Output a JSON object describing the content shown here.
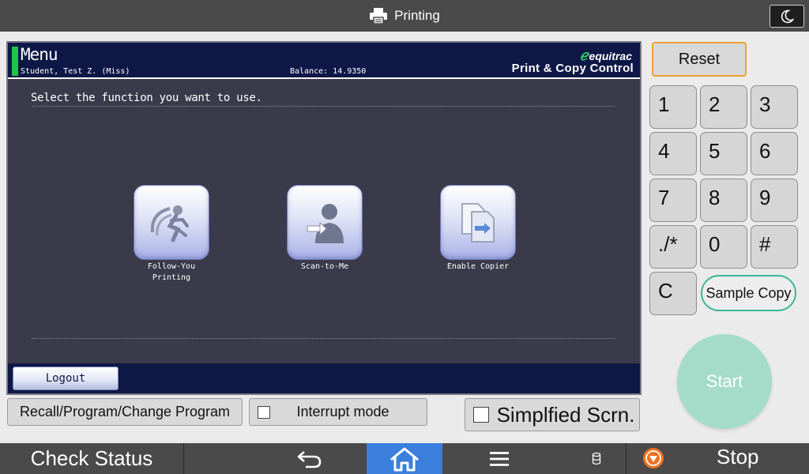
{
  "topbar": {
    "title": "Printing",
    "printer_icon": "printer-icon",
    "moon_icon": "moon-icon"
  },
  "panel": {
    "header": {
      "title": "Menu",
      "user": "Student, Test Z. (Miss)",
      "balance": "Balance: 14.9350",
      "brand_name": "equitrac",
      "brand_subtitle": "Print & Copy Control"
    },
    "instruction": "Select the function you want to use.",
    "functions": [
      {
        "label_line1": "Follow-You",
        "label_line2": "Printing",
        "icon": "follow-you-printing-icon"
      },
      {
        "label_line1": "Scan-to-Me",
        "label_line2": "",
        "icon": "scan-to-me-icon"
      },
      {
        "label_line1": "Enable Copier",
        "label_line2": "",
        "icon": "enable-copier-icon"
      }
    ],
    "logout_label": "Logout"
  },
  "controls": {
    "recall_label": "Recall/Program/Change Program",
    "interrupt_label": "Interrupt mode",
    "simplified_label": "Simplfied Scrn."
  },
  "keypad": {
    "reset_label": "Reset",
    "keys": [
      "1",
      "2",
      "3",
      "4",
      "5",
      "6",
      "7",
      "8",
      "9",
      "./*",
      "0",
      "#",
      "C"
    ],
    "sample_copy_label": "Sample Copy",
    "start_label": "Start"
  },
  "bottombar": {
    "check_status_label": "Check Status",
    "stop_label": "Stop",
    "back_icon": "back-arrow-icon",
    "home_icon": "home-icon",
    "menu_icon": "menu-icon",
    "storage_icon": "storage-icon",
    "stop_icon": "stop-icon"
  },
  "colors": {
    "topbar_bg": "#4a4a4a",
    "panel_bg": "#3a3a4a",
    "panel_header_bg": "#0e1847",
    "accent_green": "#21c24a",
    "reset_border": "#f0a030",
    "start_bg": "#a4dcc9",
    "home_active": "#3a7fdc",
    "stop_icon_color": "#f07020"
  }
}
